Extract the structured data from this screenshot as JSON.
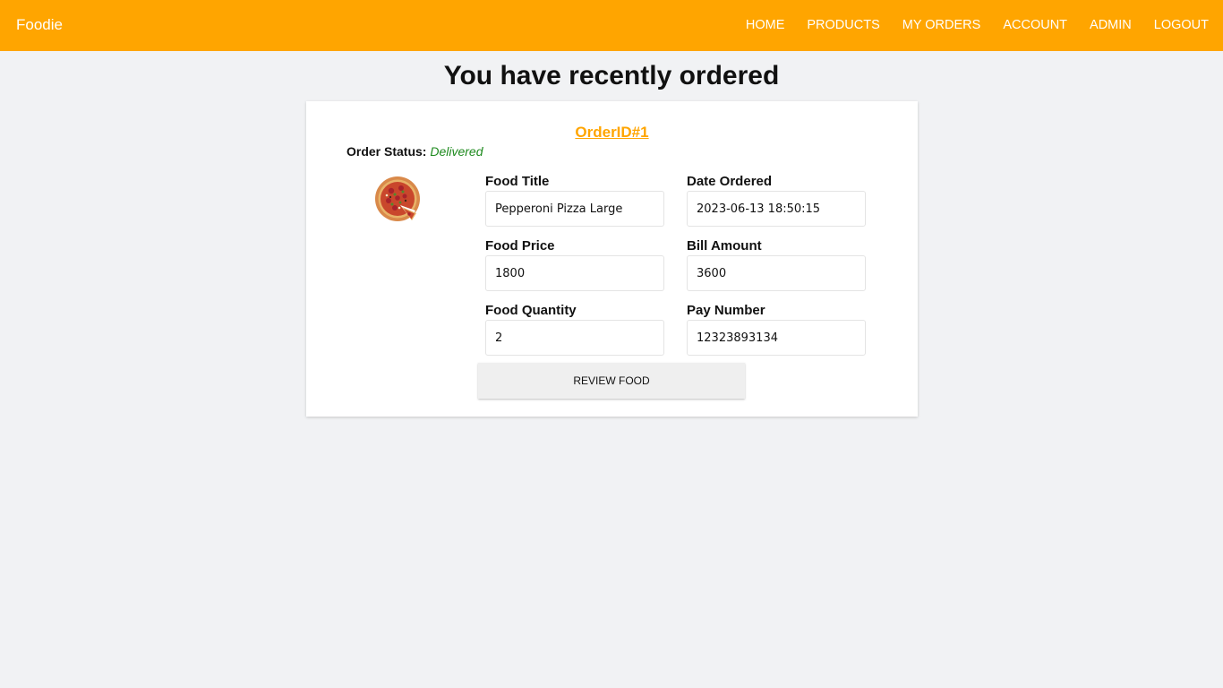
{
  "nav": {
    "brand": "Foodie",
    "links": [
      "HOME",
      "PRODUCTS",
      "MY ORDERS",
      "ACCOUNT",
      "ADMIN",
      "LOGOUT"
    ]
  },
  "page": {
    "heading": "You have recently ordered"
  },
  "order": {
    "id_label": "OrderID#1",
    "status_label": "Order Status:",
    "status_value": "Delivered",
    "status_color": "#1e8a1e",
    "image_icon": "pizza-icon",
    "fields": {
      "food_title": {
        "label": "Food Title",
        "value": "Pepperoni Pizza Large"
      },
      "date_ordered": {
        "label": "Date Ordered",
        "value": "2023-06-13 18:50:15"
      },
      "food_price": {
        "label": "Food Price",
        "value": "1800"
      },
      "bill_amount": {
        "label": "Bill Amount",
        "value": "3600"
      },
      "food_quantity": {
        "label": "Food Quantity",
        "value": "2"
      },
      "pay_number": {
        "label": "Pay Number",
        "value": "12323893134"
      }
    },
    "review_button": "REVIEW FOOD"
  },
  "colors": {
    "accent": "#ffa500",
    "background": "#f1f2f4"
  }
}
